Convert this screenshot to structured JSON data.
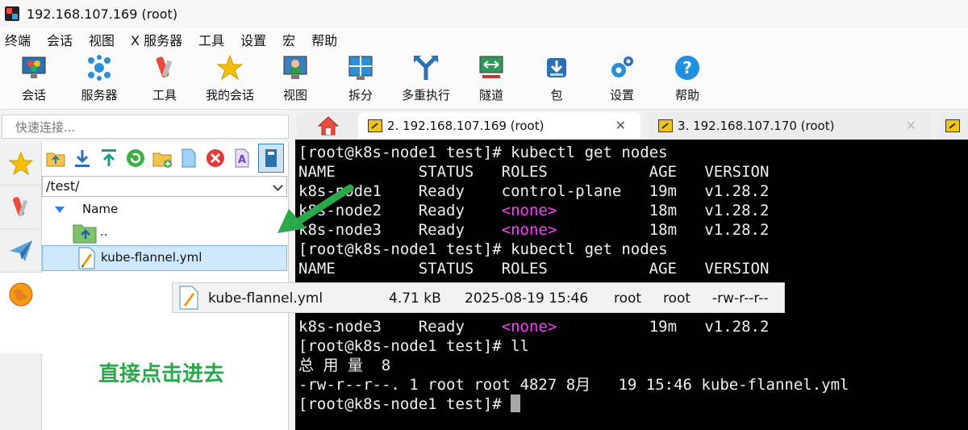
{
  "window": {
    "title": "192.168.107.169 (root)"
  },
  "menu": [
    "终端",
    "会话",
    "视图",
    "X 服务器",
    "工具",
    "设置",
    "宏",
    "帮助"
  ],
  "toolbar": [
    {
      "label": "会话",
      "icon": "session-icon"
    },
    {
      "label": "服务器",
      "icon": "servers-icon"
    },
    {
      "label": "工具",
      "icon": "tools-icon"
    },
    {
      "label": "我的会话",
      "icon": "star-icon"
    },
    {
      "label": "视图",
      "icon": "view-icon"
    },
    {
      "label": "拆分",
      "icon": "split-icon"
    },
    {
      "label": "多重执行",
      "icon": "multi-exec-icon"
    },
    {
      "label": "隧道",
      "icon": "tunnel-icon"
    },
    {
      "label": "包",
      "icon": "package-icon"
    },
    {
      "label": "设置",
      "icon": "settings-icon"
    },
    {
      "label": "帮助",
      "icon": "help-icon"
    }
  ],
  "quick_connect": {
    "placeholder": "快速连接..."
  },
  "sftp": {
    "path": "/test/",
    "column_name": "Name",
    "rows": [
      "..",
      "kube-flannel.yml"
    ]
  },
  "annotation": "直接点击进去",
  "tabs": [
    {
      "label": "2. 192.168.107.169 (root)"
    },
    {
      "label": "3. 192.168.107.170 (root)"
    }
  ],
  "terminal": [
    "[root@k8s-node1 test]# kubectl get nodes",
    "NAME         STATUS   ROLES           AGE   VERSION",
    "k8s-node1    Ready    control-plane   19m   v1.28.2",
    "k8s-node2    Ready    <none>          18m   v1.28.2",
    "k8s-node3    Ready    <none>          18m   v1.28.2",
    "[root@k8s-node1 test]# kubectl get nodes",
    "NAME         STATUS   ROLES           AGE   VERSION",
    "",
    "",
    "k8s-node3    Ready    <none>          19m   v1.28.2",
    "[root@k8s-node1 test]# ll",
    "总 用 量  8",
    "-rw-r--r--. 1 root root 4827 8月   19 15:46 kube-flannel.yml",
    "[root@k8s-node1 test]# "
  ],
  "tooltip": {
    "name": "kube-flannel.yml",
    "size": "4.71 kB",
    "modified": "2025-08-19 15:46",
    "owner": "root",
    "group": "root",
    "permissions": "-rw-r--r--"
  },
  "colors": {
    "terminal_bg": "#000000",
    "none_text": "#ff3dff",
    "annotation": "#2aa84a"
  }
}
